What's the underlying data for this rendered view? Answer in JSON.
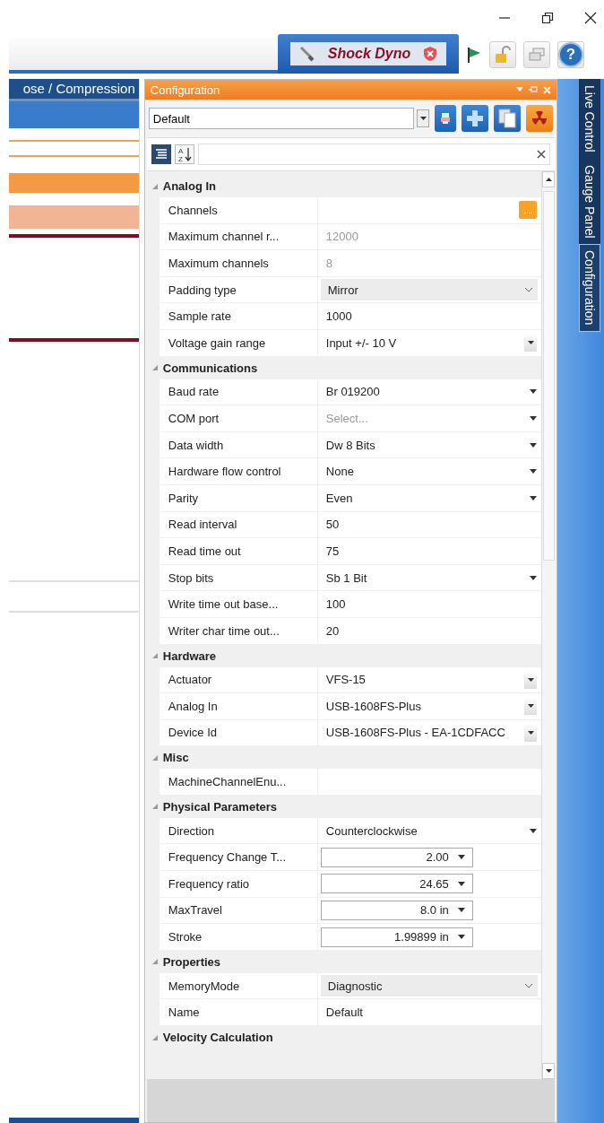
{
  "document_tab": {
    "label": "Shock Dyno",
    "selected": true
  },
  "toolbar": {
    "help_glyph": "?"
  },
  "left_pane": {
    "header": "ose / Compression"
  },
  "config_panel": {
    "title": "Configuration",
    "profile": {
      "value": "Default"
    },
    "sort_letters": [
      "A",
      "Z"
    ],
    "categories": [
      {
        "label": "Analog In",
        "expanded": true,
        "rows": [
          {
            "label": "Channels",
            "kind": "ellipsis"
          },
          {
            "label": "Maximum channel r...",
            "value": "12000",
            "kind": "readonly"
          },
          {
            "label": "Maximum channels",
            "value": "8",
            "kind": "readonly"
          },
          {
            "label": "Padding type",
            "value": "Mirror",
            "kind": "combo"
          },
          {
            "label": "Sample rate",
            "value": "1000",
            "kind": "text"
          },
          {
            "label": "Voltage gain range",
            "value": "Input +/- 10 V",
            "kind": "button-dropdown"
          }
        ]
      },
      {
        "label": "Communications",
        "expanded": true,
        "rows": [
          {
            "label": "Baud rate",
            "value": "Br 019200",
            "kind": "dropdown"
          },
          {
            "label": "COM port",
            "value": "Select...",
            "kind": "placeholder-dropdown"
          },
          {
            "label": "Data width",
            "value": "Dw 8 Bits",
            "kind": "dropdown"
          },
          {
            "label": "Hardware flow control",
            "value": "None",
            "kind": "dropdown"
          },
          {
            "label": "Parity",
            "value": "Even",
            "kind": "dropdown"
          },
          {
            "label": "Read interval",
            "value": "50",
            "kind": "text"
          },
          {
            "label": "Read time out",
            "value": "75",
            "kind": "text"
          },
          {
            "label": "Stop bits",
            "value": "Sb 1 Bit",
            "kind": "dropdown"
          },
          {
            "label": "Write time out base...",
            "value": "100",
            "kind": "text"
          },
          {
            "label": "Writer char time out...",
            "value": "20",
            "kind": "text"
          }
        ]
      },
      {
        "label": "Hardware",
        "expanded": true,
        "rows": [
          {
            "label": "Actuator",
            "value": "VFS-15",
            "kind": "button-dropdown"
          },
          {
            "label": "Analog In",
            "value": "USB-1608FS-Plus",
            "kind": "button-dropdown"
          },
          {
            "label": "Device Id",
            "value": "USB-1608FS-Plus - EA-1CDFACC",
            "kind": "button-dropdown"
          }
        ]
      },
      {
        "label": "Misc",
        "expanded": true,
        "rows": [
          {
            "label": "MachineChannelEnu...",
            "kind": "blank"
          }
        ]
      },
      {
        "label": "Physical Parameters",
        "expanded": true,
        "rows": [
          {
            "label": "Direction",
            "value": "Counterclockwise",
            "kind": "dropdown"
          },
          {
            "label": "Frequency Change T...",
            "value": "2.00",
            "kind": "spin"
          },
          {
            "label": "Frequency ratio",
            "value": "24.65",
            "kind": "spin"
          },
          {
            "label": "MaxTravel",
            "value": "8.0 in",
            "kind": "spin"
          },
          {
            "label": "Stroke",
            "value": "1.99899 in",
            "kind": "spin"
          }
        ]
      },
      {
        "label": "Properties",
        "expanded": true,
        "rows": [
          {
            "label": "MemoryMode",
            "value": "Diagnostic",
            "kind": "combo"
          },
          {
            "label": "Name",
            "value": "Default",
            "kind": "text"
          }
        ]
      },
      {
        "label": "Velocity Calculation",
        "expanded": true
      }
    ]
  },
  "side_tabs": [
    {
      "label": "Live Control",
      "selected": false
    },
    {
      "label": "Gauge Panel",
      "selected": false
    },
    {
      "label": "Configuration",
      "selected": true
    }
  ]
}
